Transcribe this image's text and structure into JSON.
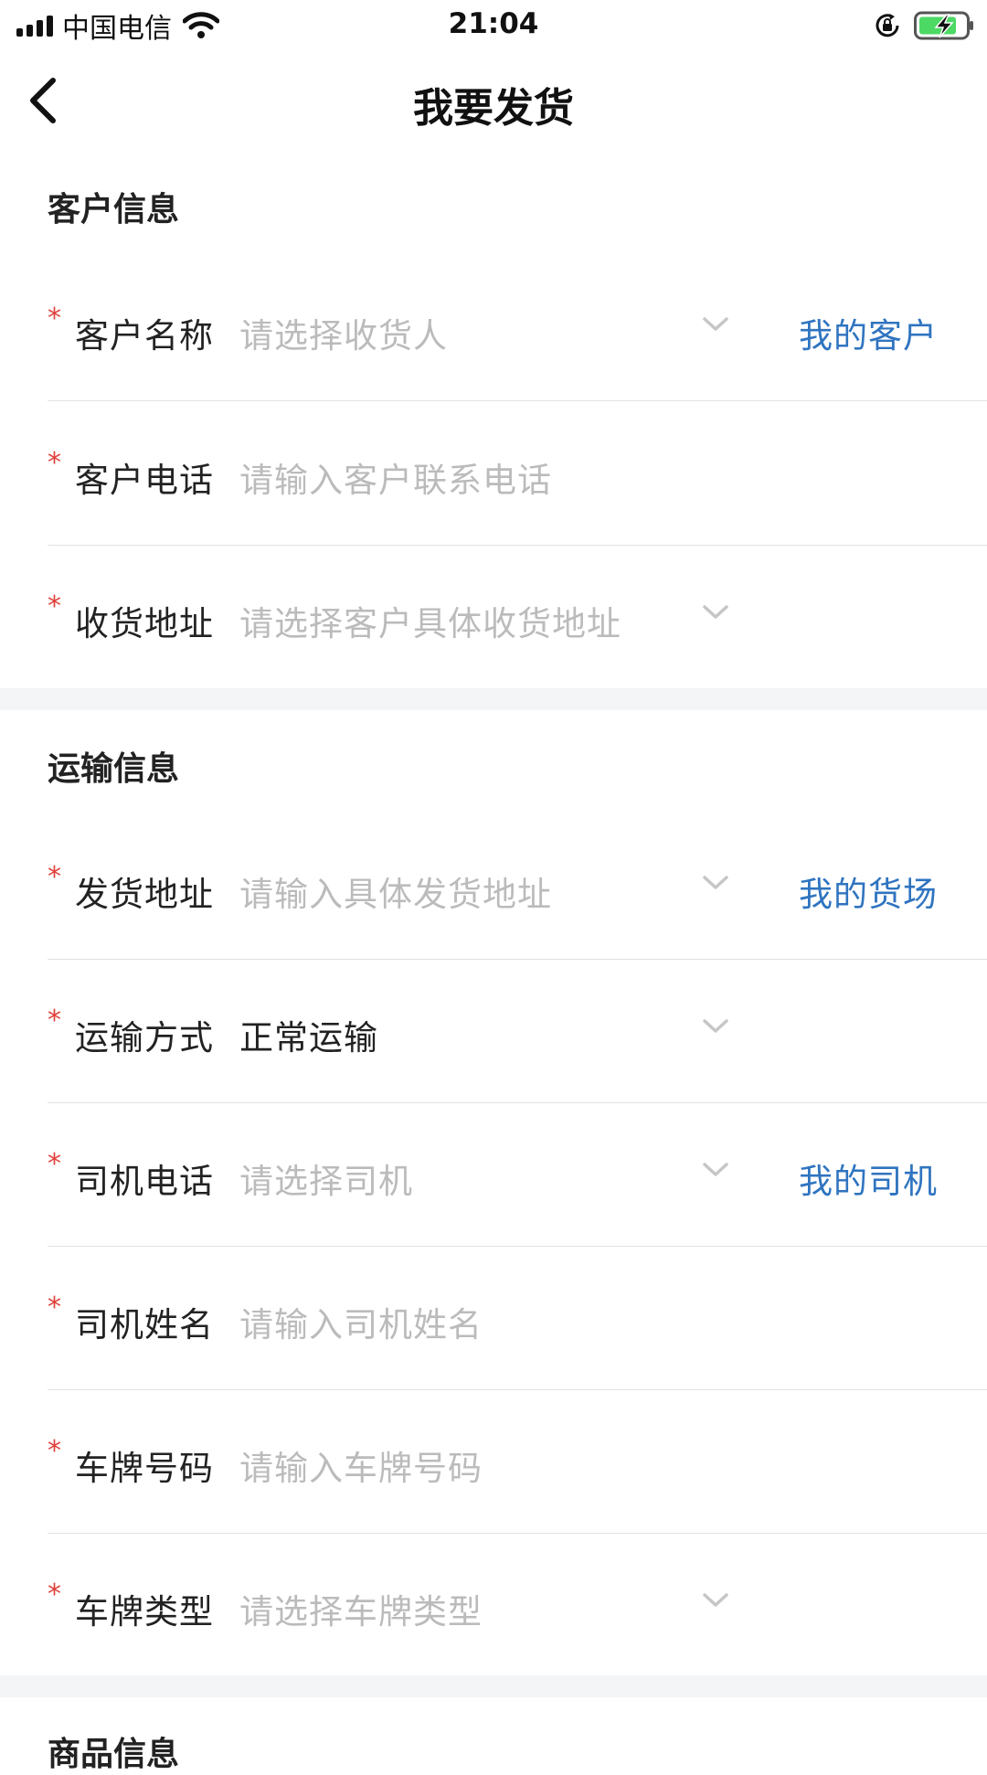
{
  "status_bar": {
    "carrier": "中国电信",
    "time": "21:04"
  },
  "nav": {
    "title": "我要发货"
  },
  "sections": {
    "customer": {
      "title": "客户信息",
      "rows": [
        {
          "label": "客户名称",
          "placeholder": "请选择收货人",
          "link": "我的客户"
        },
        {
          "label": "客户电话",
          "placeholder": "请输入客户联系电话"
        },
        {
          "label": "收货地址",
          "placeholder": "请选择客户具体收货地址"
        }
      ]
    },
    "transport": {
      "title": "运输信息",
      "rows": [
        {
          "label": "发货地址",
          "placeholder": "请输入具体发货地址",
          "link": "我的货场"
        },
        {
          "label": "运输方式",
          "value": "正常运输"
        },
        {
          "label": "司机电话",
          "placeholder": "请选择司机",
          "link": "我的司机"
        },
        {
          "label": "司机姓名",
          "placeholder": "请输入司机姓名"
        },
        {
          "label": "车牌号码",
          "placeholder": "请输入车牌号码"
        },
        {
          "label": "车牌类型",
          "placeholder": "请选择车牌类型"
        }
      ]
    },
    "goods": {
      "title": "商品信息"
    }
  },
  "required_mark": "*",
  "colors": {
    "required": "#e0403a",
    "link": "#2f74c0",
    "placeholder": "#bbbbbb",
    "section_gap": "#f4f5f7"
  },
  "icons": [
    "signal-icon",
    "wifi-icon",
    "rotation-lock-icon",
    "battery-charging-icon",
    "back-arrow-icon",
    "chevron-down-icon"
  ]
}
